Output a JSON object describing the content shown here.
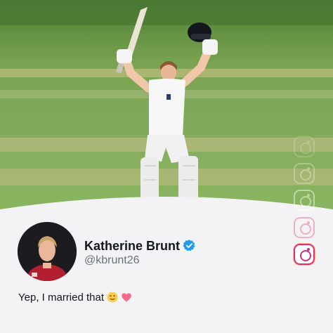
{
  "post": {
    "author_name": "Katherine Brunt",
    "author_handle": "@kbrunt26",
    "text": "Yep, I married that"
  },
  "icons": {
    "verified": "verified-badge-icon",
    "emoji_wink": "winking-face-emoji",
    "emoji_heart": "pink-heart-emoji",
    "watermark": "instagram-icon"
  },
  "colors": {
    "verified_blue": "#1d9bf0",
    "heart_pink": "#f36a8c",
    "grass_light": "#8fb566",
    "grass_dark": "#6e9a4e",
    "instagram_accent": "#e1306c"
  }
}
